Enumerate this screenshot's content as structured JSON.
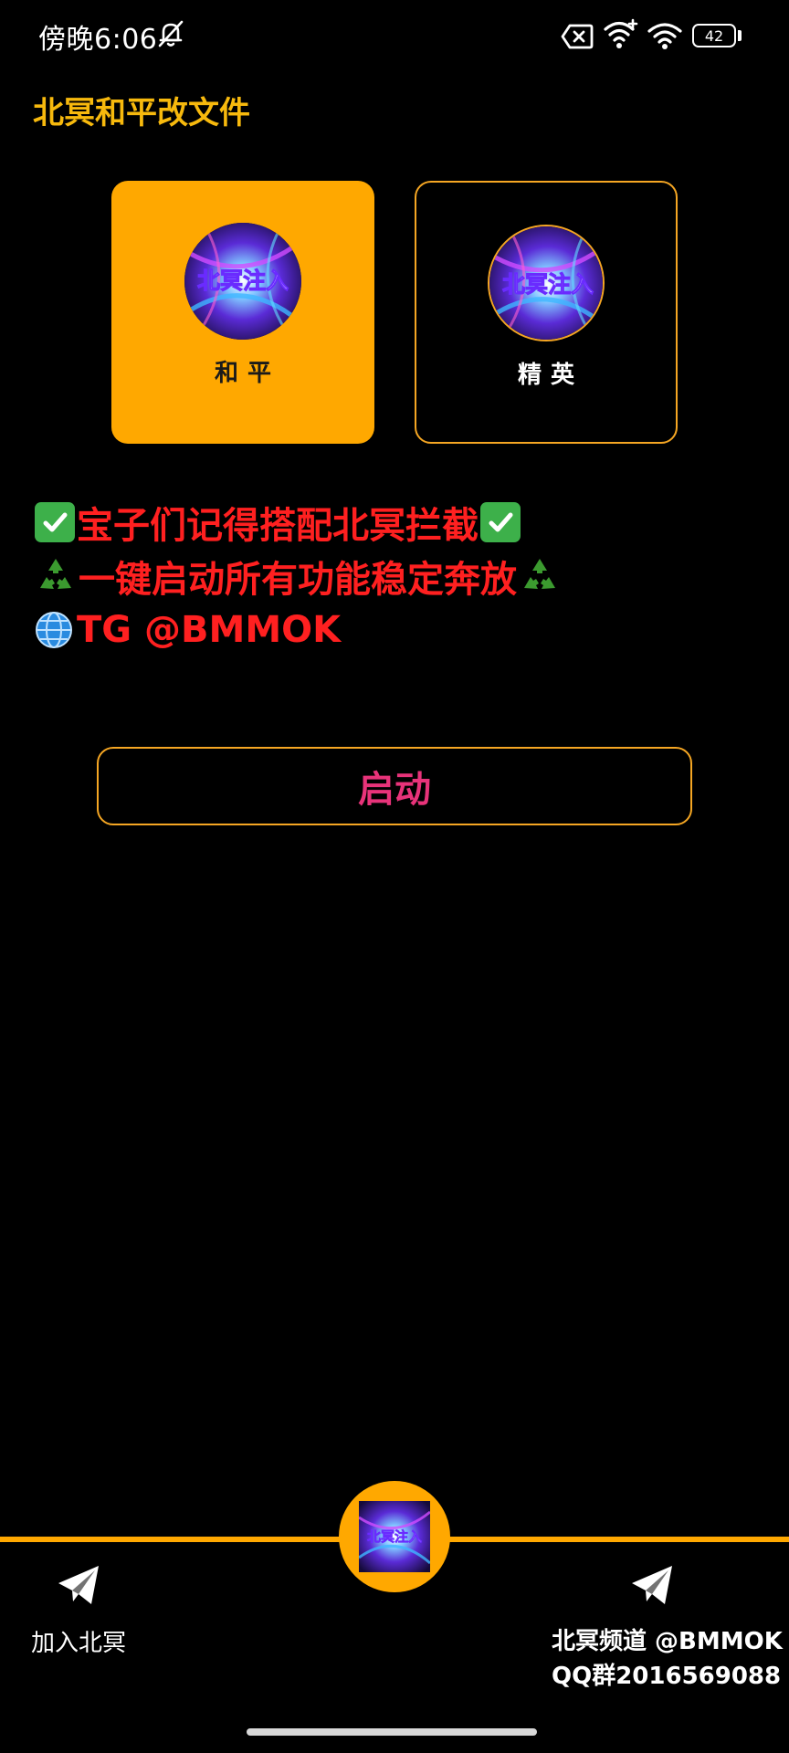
{
  "status_bar": {
    "time": "傍晚6:06",
    "battery": "42",
    "icons": [
      "bell-off-icon",
      "sim-error-icon",
      "wifi-icon",
      "wifi-icon"
    ]
  },
  "header": {
    "title": "北冥和平改文件"
  },
  "modes": [
    {
      "label": "和平",
      "logo_text": "北冥注入",
      "selected": true
    },
    {
      "label": "精英",
      "logo_text": "北冥注入",
      "selected": false
    }
  ],
  "notice": {
    "line1": "宝子们记得搭配北冥拦截",
    "line2": "一键启动所有功能稳定奔放",
    "line3": "TG @BMMOK"
  },
  "start_button": {
    "label": "启动"
  },
  "bottom_nav": {
    "left_label": "加入北冥",
    "center_logo_text": "北冥注入",
    "right_line1": "北冥频道 @BMMOK",
    "right_line2": "QQ群2016569088"
  },
  "colors": {
    "accent": "#ffa800",
    "title": "#f7b90d",
    "notice_text": "#ff2020",
    "button_text": "#e8337a",
    "background": "#000000"
  }
}
